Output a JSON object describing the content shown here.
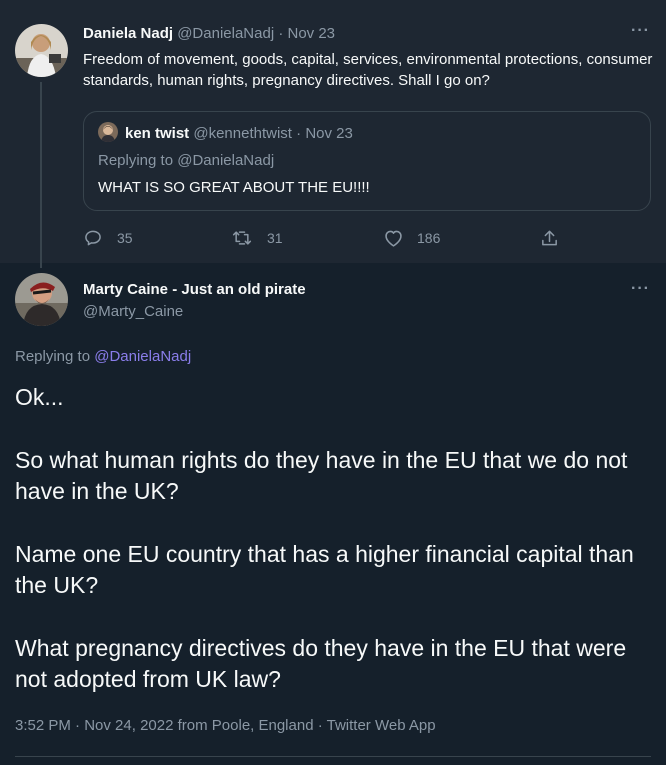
{
  "parent_tweet": {
    "author_name": "Daniela Nadj",
    "author_handle": "@DanielaNadj",
    "separator": "·",
    "date": "Nov 23",
    "text": "Freedom of movement, goods, capital, services, environmental protections, consumer standards, human rights, pregnancy directives. Shall I go on?",
    "more_label": "···",
    "quoted_tweet": {
      "author_name": "ken twist",
      "author_handle": "@kennethtwist",
      "separator": "·",
      "date": "Nov 23",
      "replying_to": "Replying to @DanielaNadj",
      "text": "WHAT IS SO GREAT ABOUT THE EU!!!!"
    },
    "actions": {
      "reply_count": "35",
      "retweet_count": "31",
      "like_count": "186",
      "reply_icon": "reply-icon",
      "retweet_icon": "retweet-icon",
      "like_icon": "heart-icon",
      "share_icon": "share-icon"
    }
  },
  "main_tweet": {
    "author_name": "Marty Caine - Just an old pirate",
    "author_handle": "@Marty_Caine",
    "more_label": "···",
    "replying_prefix": "Replying to",
    "replying_handle": "@DanielaNadj",
    "paragraphs": [
      "Ok...",
      "So what human rights do they have in the EU that we do not have in the UK?",
      "Name one EU country that has a higher financial capital than the UK?",
      "What pregnancy directives do they have in the EU that were not adopted from UK law?"
    ],
    "time": "3:52 PM",
    "date": "Nov 24, 2022",
    "location": "from Poole, England",
    "source": "Twitter Web App",
    "separator": "·"
  },
  "colors": {
    "background": "#15202b",
    "parent_background": "#1e2732",
    "text": "#f7f9f9",
    "muted": "#8b98a5",
    "link": "#8a7dea",
    "border": "#38444d"
  }
}
